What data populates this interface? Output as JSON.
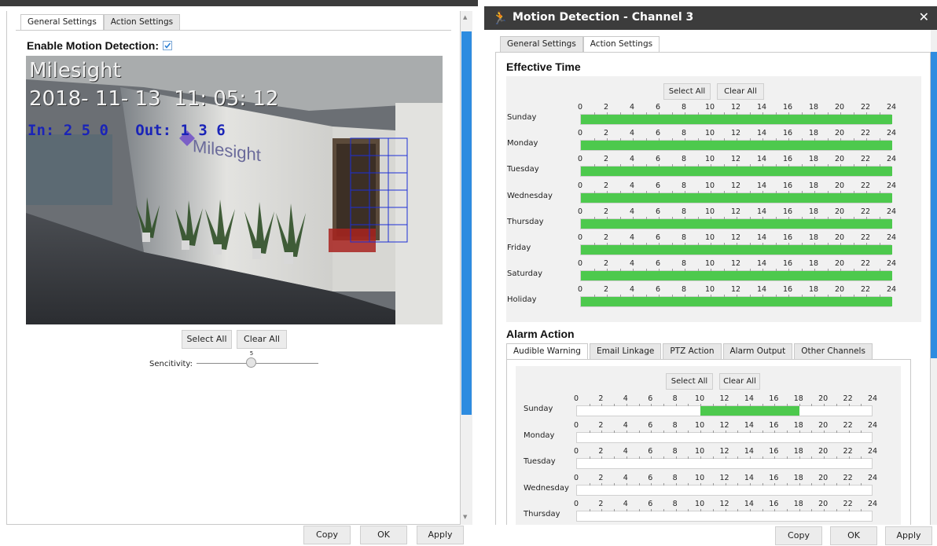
{
  "left": {
    "tabs": [
      "General Settings",
      "Action Settings"
    ],
    "enable_label": "Enable Motion Detection:",
    "enable_checked": true,
    "video": {
      "brand": "Milesight",
      "timestamp": "2018- 11- 13  11: 05: 12",
      "counter": "In: 2 5 0   Out: 1 3 6",
      "logo_text": "Milesight"
    },
    "select_all": "Select All",
    "clear_all": "Clear All",
    "sensitivity_label": "Sencitivity:",
    "sensitivity_value": "5",
    "sensitivity_fraction": 0.45,
    "footer": {
      "copy": "Copy",
      "ok": "OK",
      "apply": "Apply"
    }
  },
  "right": {
    "title": "Motion Detection - Channel 3",
    "close": "✕",
    "tabs": [
      "General Settings",
      "Action Settings"
    ],
    "effective_time_heading": "Effective Time",
    "select_all": "Select All",
    "clear_all": "Clear All",
    "hours": [
      "0",
      "2",
      "4",
      "6",
      "8",
      "10",
      "12",
      "14",
      "16",
      "18",
      "20",
      "22",
      "24"
    ],
    "effective_days": [
      {
        "label": "Sunday",
        "start": 0,
        "end": 24
      },
      {
        "label": "Monday",
        "start": 0,
        "end": 24
      },
      {
        "label": "Tuesday",
        "start": 0,
        "end": 24
      },
      {
        "label": "Wednesday",
        "start": 0,
        "end": 24
      },
      {
        "label": "Thursday",
        "start": 0,
        "end": 24
      },
      {
        "label": "Friday",
        "start": 0,
        "end": 24
      },
      {
        "label": "Saturday",
        "start": 0,
        "end": 24
      },
      {
        "label": "Holiday",
        "start": 0,
        "end": 24
      }
    ],
    "alarm_action_heading": "Alarm Action",
    "alarm_tabs": [
      "Audible Warning",
      "Email Linkage",
      "PTZ Action",
      "Alarm Output",
      "Other Channels"
    ],
    "alarm_select_all": "Select All",
    "alarm_clear_all": "Clear All",
    "alarm_days": [
      {
        "label": "Sunday",
        "start": 10,
        "end": 18
      },
      {
        "label": "Monday",
        "start": 0,
        "end": 0
      },
      {
        "label": "Tuesday",
        "start": 0,
        "end": 0
      },
      {
        "label": "Wednesday",
        "start": 0,
        "end": 0
      },
      {
        "label": "Thursday",
        "start": 0,
        "end": 0
      }
    ],
    "footer": {
      "copy": "Copy",
      "ok": "OK",
      "apply": "Apply"
    }
  },
  "colors": {
    "active_green": "#4dc94d",
    "scroll_blue": "#2e8ce0",
    "title_bar": "#3c3c3c"
  }
}
